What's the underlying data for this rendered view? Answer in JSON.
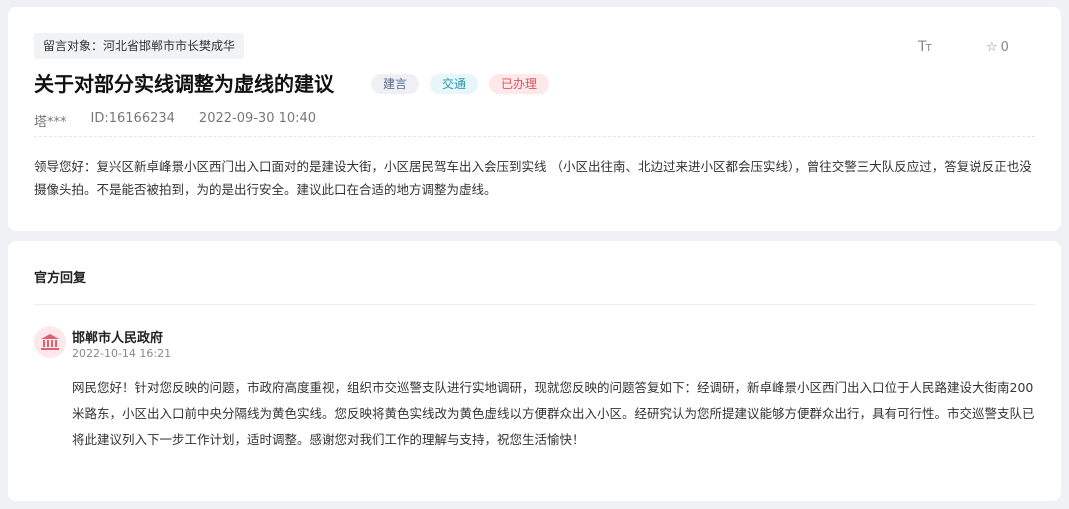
{
  "main": {
    "target": "留言对象：河北省邯郸市市长樊成华",
    "title": "关于对部分实线调整为虚线的建议",
    "badges": {
      "type": "建言",
      "category": "交通",
      "status": "已办理"
    },
    "tools": {
      "font_size_glyph": "TT",
      "star_count": "0"
    },
    "meta": {
      "author": "塔***",
      "id": "ID:16166234",
      "datetime": "2022-09-30 10:40"
    },
    "content": "领导您好：复兴区新卓峰景小区西门出入口面对的是建设大街，小区居民驾车出入会压到实线 （小区出往南、北边过来进小区都会压实线），曾往交警三大队反应过，答复说反正也没摄像头拍。不是能否被拍到，为的是出行安全。建议此口在合适的地方调整为虚线。"
  },
  "reply": {
    "section_title": "官方回复",
    "org_name": "邯郸市人民政府",
    "datetime": "2022-10-14 16:21",
    "content": "网民您好！针对您反映的问题，市政府高度重视，组织市交巡警支队进行实地调研，现就您反映的问题答复如下：经调研，新卓峰景小区西门出入口位于人民路建设大街南200米路东，小区出入口前中央分隔线为黄色实线。您反映将黄色实线改为黄色虚线以方便群众出入小区。经研究认为您所提建议能够方便群众出行，具有可行性。市交巡警支队已将此建议列入下一步工作计划，适时调整。感谢您对我们工作的理解与支持，祝您生活愉快！"
  },
  "colors": {
    "status_red": "#e05060",
    "category_teal": "#2a97b0",
    "page_bg": "#f0f1f4"
  },
  "icons": {
    "font_size": "font-size-icon",
    "star": "star-icon",
    "org": "government-building-icon"
  }
}
